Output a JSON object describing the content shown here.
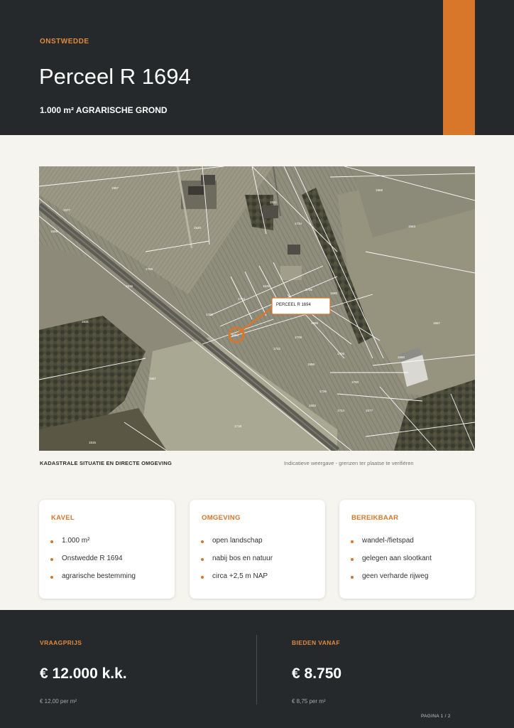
{
  "header": {
    "location": "ONSTWEDDE",
    "title": "Perceel R 1694",
    "subtitle": "1.000 m² AGRARISCHE GROND"
  },
  "map": {
    "callout_label": "PERCEEL R 1694",
    "caption_left": "KADASTRALE SITUATIE EN DIRECTE OMGEVING",
    "caption_right": "Indicatieve weergave - grenzen ter plaatse te verifiëren",
    "accent_color": "#d8762a"
  },
  "cards": [
    {
      "title": "KAVEL",
      "items": [
        "1.000 m²",
        "Onstwedde R 1694",
        "agrarische bestemming"
      ]
    },
    {
      "title": "OMGEVING",
      "items": [
        "open landschap",
        "nabij bos en natuur",
        "circa +2,5 m NAP"
      ]
    },
    {
      "title": "BEREIKBAAR",
      "items": [
        "wandel-/fietspad",
        "gelegen aan slootkant",
        "geen verharde rijweg"
      ]
    }
  ],
  "pricing": {
    "asking": {
      "label": "VRAAGPRIJS",
      "value": "€ 12.000 k.k.",
      "note": "€ 12,00 per m²"
    },
    "bid": {
      "label": "BIEDEN VANAF",
      "value": "€ 8.750",
      "note": "€ 8,75 per m²"
    }
  },
  "page_number": "PAGINA 1 / 2",
  "colors": {
    "header_bg": "#25292c",
    "accent": "#d8762a",
    "page_bg": "#f5f4ef"
  }
}
